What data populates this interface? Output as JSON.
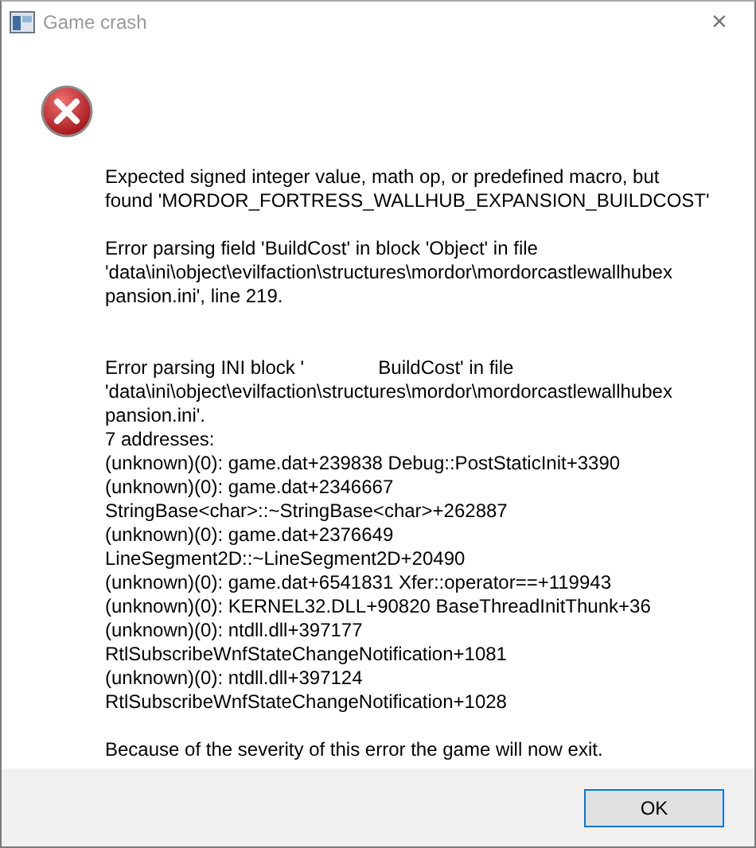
{
  "window": {
    "title": "Game crash",
    "close": "×"
  },
  "message": {
    "paragraphs": [
      {
        "lines": [
          "Expected signed integer value, math op, or predefined macro, but",
          "found 'MORDOR_FORTRESS_WALLHUB_EXPANSION_BUILDCOST'"
        ]
      },
      {
        "lines": [
          "Error parsing field 'BuildCost' in block 'Object' in file",
          "'data\\ini\\object\\evilfaction\\structures\\mordor\\mordorcastlewallhubex",
          "pansion.ini', line 219."
        ]
      },
      {
        "lines": [
          "Error parsing INI block '              BuildCost' in file",
          "'data\\ini\\object\\evilfaction\\structures\\mordor\\mordorcastlewallhubex",
          "pansion.ini'.",
          "7 addresses:",
          "(unknown)(0): game.dat+239838 Debug::PostStaticInit+3390",
          "(unknown)(0): game.dat+2346667",
          "StringBase<char>::~StringBase<char>+262887",
          "(unknown)(0): game.dat+2376649",
          "LineSegment2D::~LineSegment2D+20490",
          "(unknown)(0): game.dat+6541831 Xfer::operator==+119943",
          "(unknown)(0): KERNEL32.DLL+90820 BaseThreadInitThunk+36",
          "(unknown)(0): ntdll.dll+397177",
          "RtlSubscribeWnfStateChangeNotification+1081",
          "(unknown)(0): ntdll.dll+397124",
          "RtlSubscribeWnfStateChangeNotification+1028"
        ]
      },
      {
        "lines": [
          "Because of the severity of this error the game will now exit."
        ]
      }
    ]
  },
  "buttons": [
    {
      "label": "OK",
      "default": true
    }
  ]
}
